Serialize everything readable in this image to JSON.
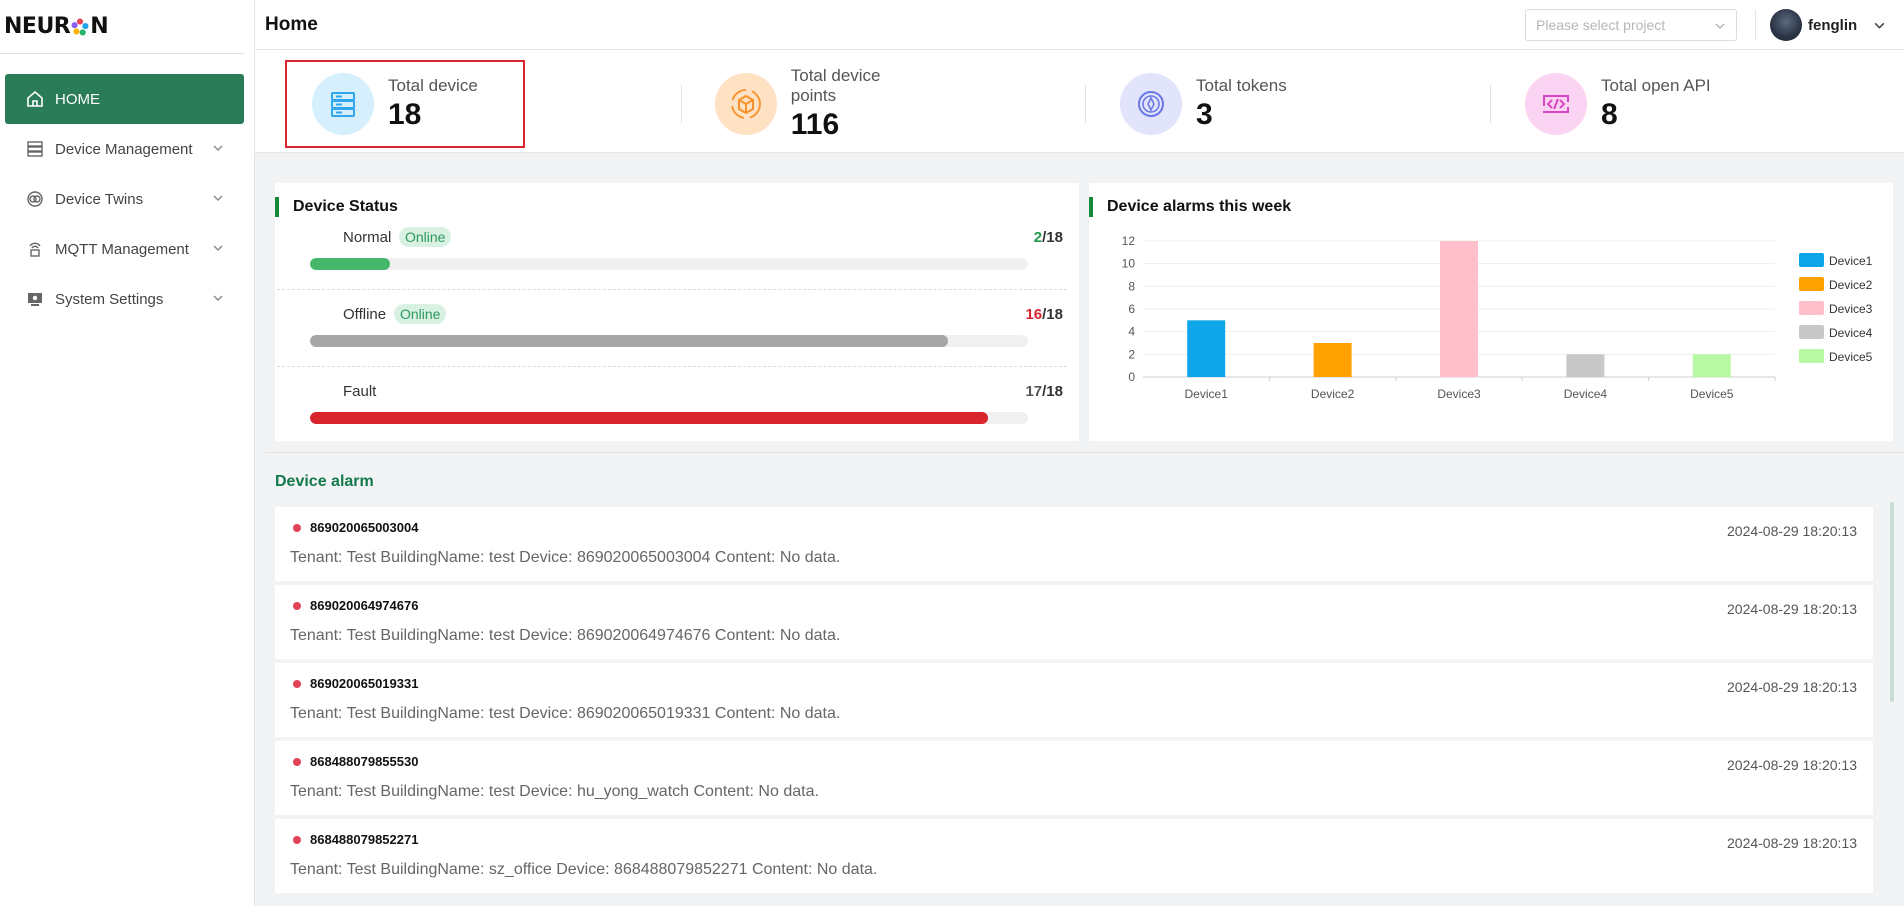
{
  "header": {
    "page_title": "Home",
    "project_placeholder": "Please select project",
    "username": "fenglin"
  },
  "sidebar": {
    "items": [
      {
        "label": "HOME",
        "icon": "home-icon",
        "active": true
      },
      {
        "label": "Device Management",
        "icon": "server-icon"
      },
      {
        "label": "Device Twins",
        "icon": "twins-icon"
      },
      {
        "label": "MQTT Management",
        "icon": "mqtt-icon"
      },
      {
        "label": "System Settings",
        "icon": "monitor-icon"
      }
    ]
  },
  "stats": [
    {
      "label": "Total device",
      "value": "18",
      "icon": "device-server-icon"
    },
    {
      "label": "Total device points",
      "value": "116",
      "icon": "box-icon"
    },
    {
      "label": "Total tokens",
      "value": "3",
      "icon": "token-icon"
    },
    {
      "label": "Total open API",
      "value": "8",
      "icon": "api-code-icon"
    }
  ],
  "device_status": {
    "title": "Device Status",
    "rows": [
      {
        "label": "Normal",
        "badge": "Online",
        "count": "2",
        "total": "/18",
        "fraction": 0.111,
        "color": "#45b86b",
        "count_color": "#1e9a4e"
      },
      {
        "label": "Offline",
        "badge": "Online",
        "count": "16",
        "total": "/18",
        "fraction": 0.889,
        "color": "#a6a6a6",
        "count_color": "#d9232d"
      },
      {
        "label": "Fault",
        "badge": "",
        "count": "17",
        "total": "/18",
        "fraction": 0.944,
        "color": "#d9232d",
        "count_color": "#333333"
      }
    ]
  },
  "alarm_chart_title": "Device alarms this week",
  "chart_data": {
    "type": "bar",
    "title": "Device alarms this week",
    "categories": [
      "Device1",
      "Device2",
      "Device3",
      "Device4",
      "Device5"
    ],
    "values": [
      5,
      3,
      12,
      2,
      2
    ],
    "colors": [
      "#0ea5e9",
      "#ffa200",
      "#ffc0cb",
      "#c8c8c8",
      "#b9f8a3"
    ],
    "legend": [
      "Device1",
      "Device2",
      "Device3",
      "Device4",
      "Device5"
    ],
    "yticks": [
      "0",
      "2",
      "4",
      "6",
      "8",
      "10",
      "12"
    ],
    "ylim": [
      0,
      12
    ],
    "legend_position": "right"
  },
  "device_alarm": {
    "title": "Device alarm",
    "items": [
      {
        "id": "869020065003004",
        "time": "2024-08-29 18:20:13",
        "content": "Tenant: Test BuildingName: test Device: 869020065003004 Content: No data."
      },
      {
        "id": "869020064974676",
        "time": "2024-08-29 18:20:13",
        "content": "Tenant: Test BuildingName: test Device: 869020064974676 Content: No data."
      },
      {
        "id": "869020065019331",
        "time": "2024-08-29 18:20:13",
        "content": "Tenant: Test BuildingName: test Device: 869020065019331 Content: No data."
      },
      {
        "id": "868488079855530",
        "time": "2024-08-29 18:20:13",
        "content": "Tenant: Test BuildingName: test Device: hu_yong_watch Content: No data."
      },
      {
        "id": "868488079852271",
        "time": "2024-08-29 18:20:13",
        "content": "Tenant: Test BuildingName: sz_office Device: 868488079852271 Content: No data."
      }
    ]
  }
}
